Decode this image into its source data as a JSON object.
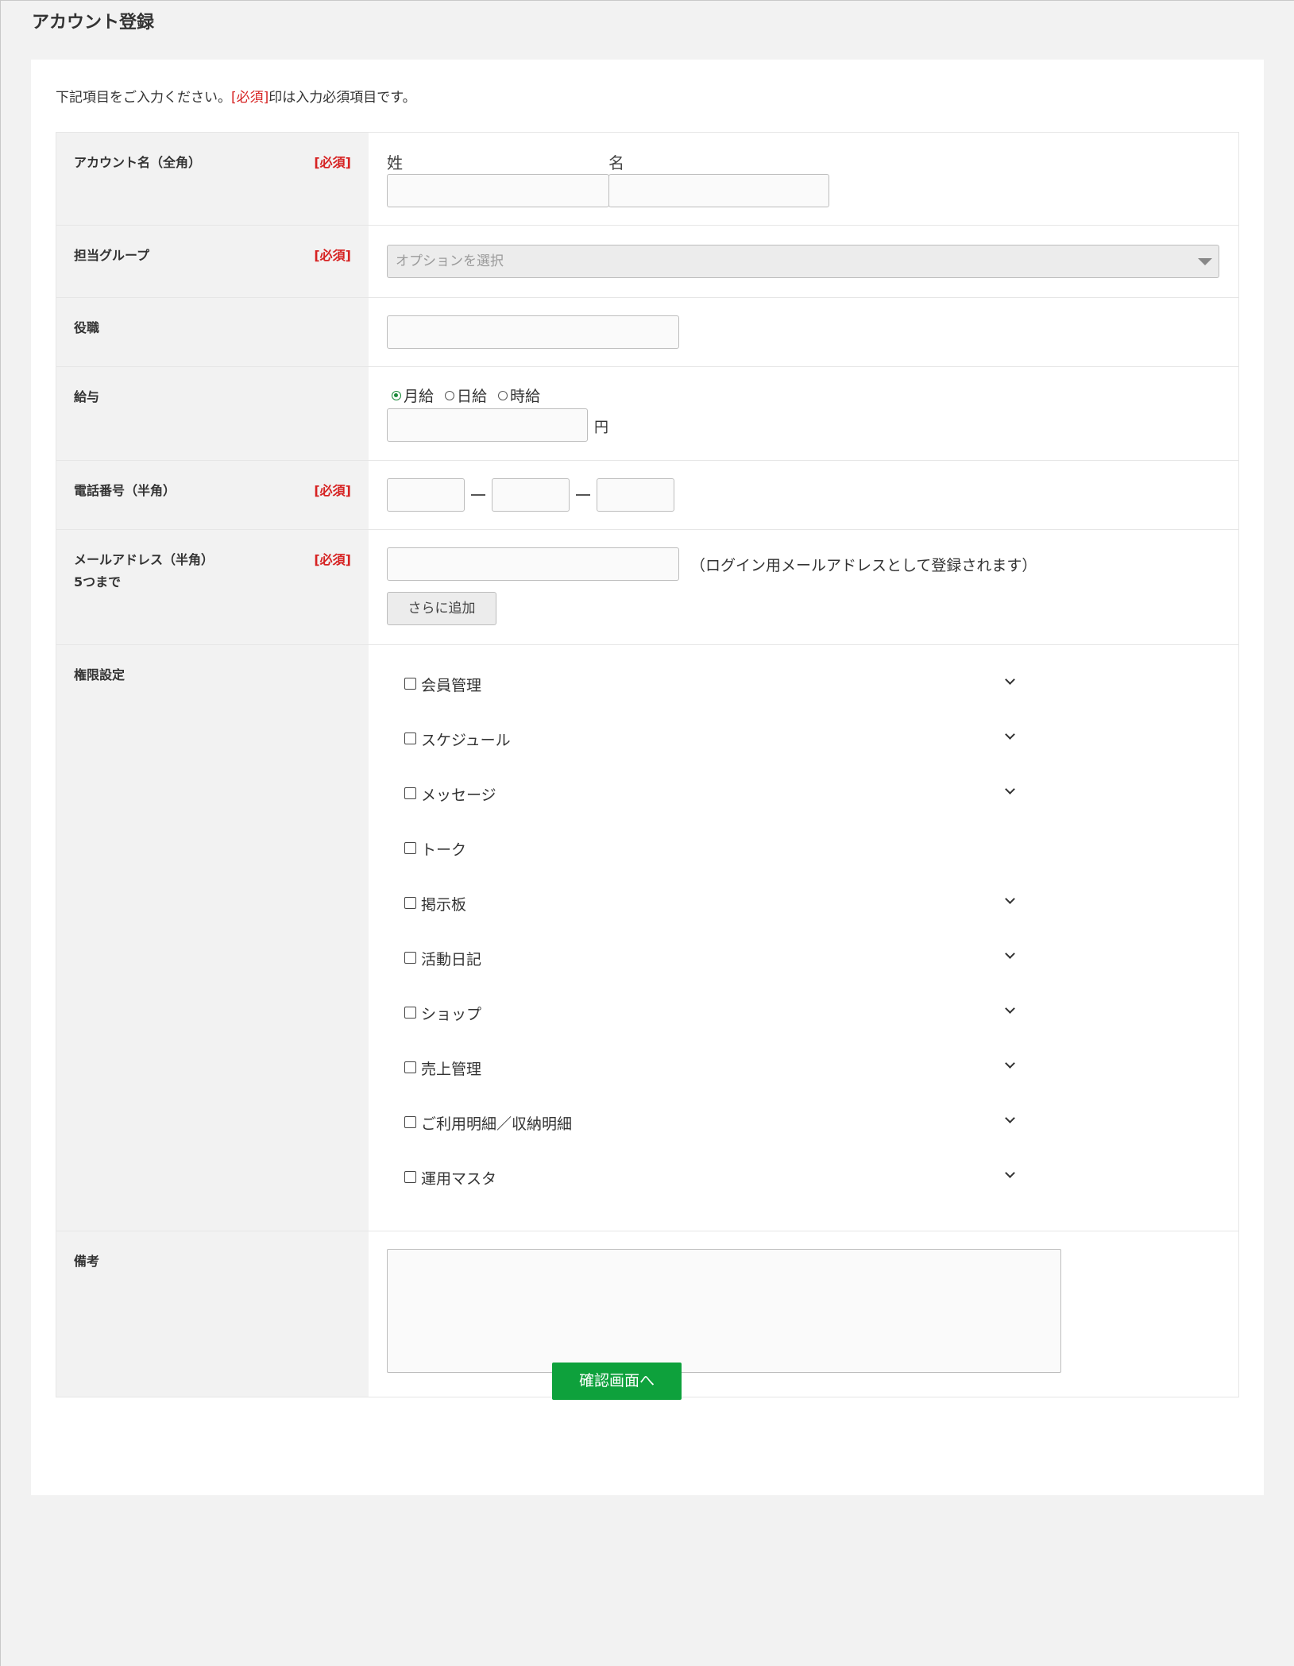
{
  "page": {
    "title": "アカウント登録",
    "intro_prefix": "下記項目をご入力ください。",
    "intro_req": "[必須]",
    "intro_suffix": "印は入力必須項目です。"
  },
  "required_tag": "[必須]",
  "rows": {
    "account_name": {
      "label": "アカウント名（全角）",
      "last_label": "姓",
      "first_label": "名",
      "last_value": "",
      "first_value": ""
    },
    "group": {
      "label": "担当グループ",
      "placeholder": "オプションを選択"
    },
    "position": {
      "label": "役職",
      "value": ""
    },
    "salary": {
      "label": "給与",
      "options": [
        "月給",
        "日給",
        "時給"
      ],
      "selected": "月給",
      "unit": "円",
      "value": ""
    },
    "phone": {
      "label": "電話番号（半角）",
      "part1": "",
      "part2": "",
      "part3": ""
    },
    "email": {
      "label": "メールアドレス（半角）",
      "sublabel": "5つまで",
      "value": "",
      "note": "（ログイン用メールアドレスとして登録されます）",
      "add_button": "さらに追加"
    },
    "permissions": {
      "label": "権限設定",
      "items": [
        {
          "label": "会員管理",
          "expandable": true
        },
        {
          "label": "スケジュール",
          "expandable": true
        },
        {
          "label": "メッセージ",
          "expandable": true
        },
        {
          "label": "トーク",
          "expandable": false
        },
        {
          "label": "掲示板",
          "expandable": true
        },
        {
          "label": "活動日記",
          "expandable": true
        },
        {
          "label": "ショップ",
          "expandable": true
        },
        {
          "label": "売上管理",
          "expandable": true
        },
        {
          "label": "ご利用明細／収納明細",
          "expandable": true
        },
        {
          "label": "運用マスタ",
          "expandable": true
        }
      ]
    },
    "remarks": {
      "label": "備考",
      "value": ""
    }
  },
  "submit_button": "確認画面へ",
  "colors": {
    "accent_green": "#0ea13c",
    "required_red": "#d62222",
    "radio_green": "#1a8a3a"
  }
}
